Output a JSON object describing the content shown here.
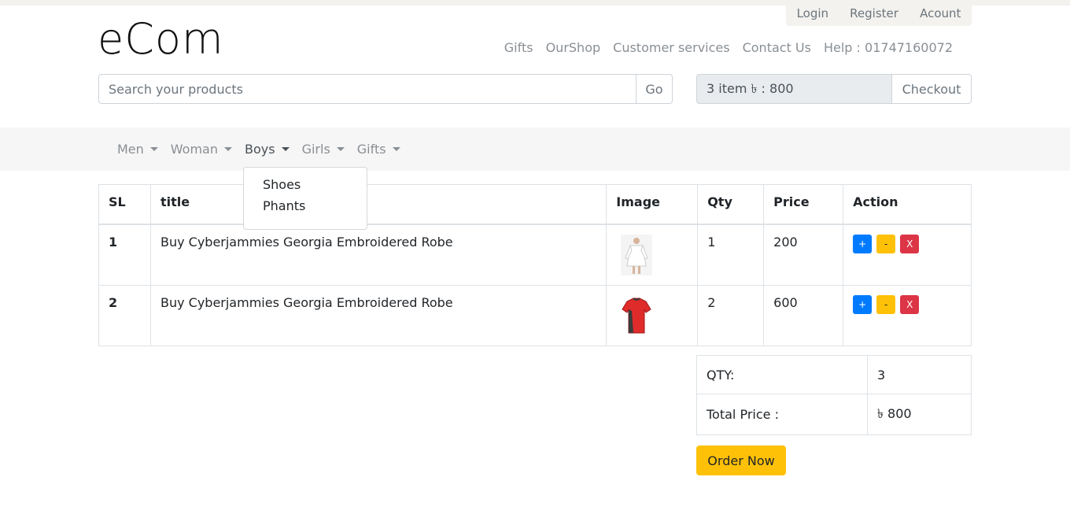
{
  "account_menu": [
    "Login",
    "Register",
    "Acount"
  ],
  "logo": "eCom",
  "header_links": [
    "Gifts",
    "OurShop",
    "Customer services",
    "Contact Us",
    "Help : 01747160072"
  ],
  "search": {
    "placeholder": "Search your products",
    "button": "Go"
  },
  "cart": {
    "summary": "3 item  ৳ : 800",
    "checkout": "Checkout"
  },
  "nav": [
    "Men",
    "Woman",
    "Boys",
    "Girls",
    "Gifts"
  ],
  "dropdown": [
    "Shoes",
    "Phants"
  ],
  "table": {
    "headers": [
      "SL",
      "title",
      "Image",
      "Qty",
      "Price",
      "Action"
    ],
    "rows": [
      {
        "sl": "1",
        "title": "Buy Cyberjammies Georgia Embroidered Robe",
        "qty": "1",
        "price": "200",
        "image": "white-robe"
      },
      {
        "sl": "2",
        "title": "Buy Cyberjammies Georgia Embroidered Robe",
        "qty": "2",
        "price": "600",
        "image": "red-tshirt"
      }
    ],
    "actions": {
      "plus": "+",
      "minus": "-",
      "remove": "X"
    }
  },
  "totals": {
    "qty_label": "QTY:",
    "qty_value": "3",
    "price_label": "Total Price :",
    "price_value": "৳ 800"
  },
  "order_button": "Order Now",
  "colors": {
    "primary": "#007bff",
    "warning": "#ffc107",
    "danger": "#dc3545"
  }
}
